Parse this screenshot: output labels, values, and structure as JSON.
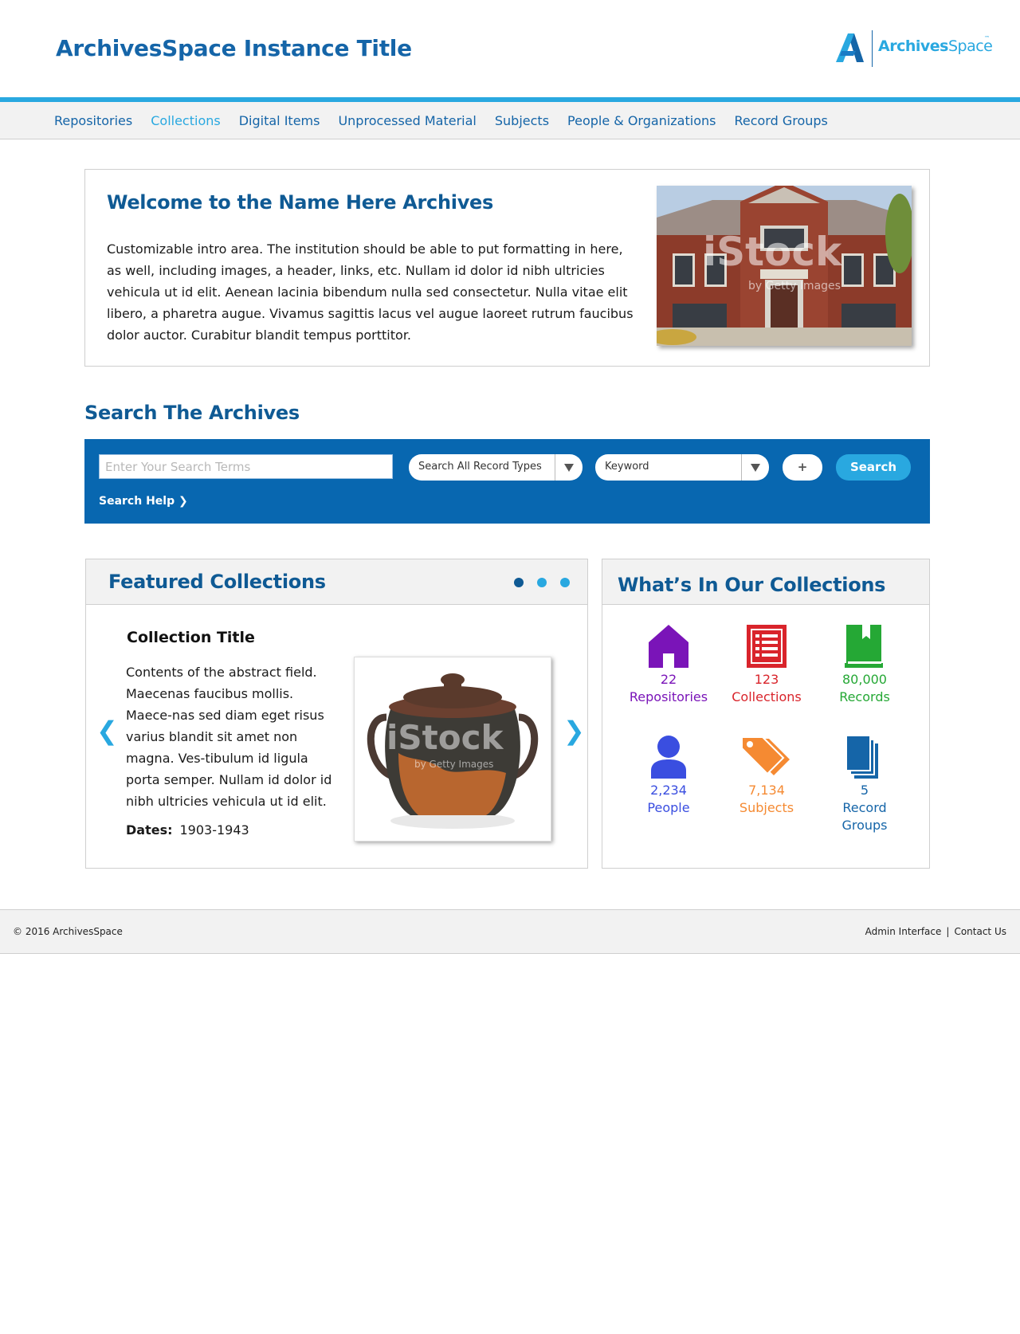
{
  "header": {
    "site_title": "ArchivesSpace Instance Title",
    "logo_text_bold": "Archives",
    "logo_text_light": "Space",
    "logo_tm": "™"
  },
  "nav": {
    "items": [
      {
        "label": "Repositories",
        "active": false
      },
      {
        "label": "Collections",
        "active": true
      },
      {
        "label": "Digital Items",
        "active": false
      },
      {
        "label": "Unprocessed Material",
        "active": false
      },
      {
        "label": "Subjects",
        "active": false
      },
      {
        "label": "People & Organizations",
        "active": false
      },
      {
        "label": "Record Groups",
        "active": false
      }
    ]
  },
  "welcome": {
    "title": "Welcome to the Name Here Archives",
    "body": "Customizable intro area. The institution should be able to put formatting in here, as well, including images, a header, links, etc. Nullam id dolor id nibh ultricies vehicula ut id elit. Aenean lacinia bibendum nulla sed consectetur. Nulla vitae elit libero, a pharetra augue. Vivamus sagittis lacus vel augue laoreet rutrum faucibus dolor auctor. Curabitur blandit tempus porttitor.",
    "photo_watermark": "iStock",
    "photo_watermark_sub": "by Getty Images"
  },
  "search": {
    "heading": "Search The Archives",
    "input_placeholder": "Enter Your Search Terms",
    "record_type_select": "Search All Record Types",
    "field_select": "Keyword",
    "plus_label": "+",
    "button_label": "Search",
    "help_label": "Search Help ❯"
  },
  "featured": {
    "title": "Featured Collections",
    "slide_count": 3,
    "active_slide": 1,
    "collection_title": "Collection Title",
    "abstract": "Contents of the abstract field. Maecenas faucibus mollis. Maece-nas sed diam eget risus varius blandit sit amet non magna. Ves-tibulum id ligula porta semper. Nullam id dolor id nibh ultricies vehicula ut id elit.",
    "dates_label": "Dates:",
    "dates_value": "1903-1943",
    "prev_arrow": "❮",
    "next_arrow": "❯",
    "photo_watermark": "iStock",
    "photo_watermark_sub": "by Getty Images"
  },
  "stats": {
    "title": "What’s In Our Collections",
    "items": [
      {
        "count": "22",
        "label": "Repositories",
        "icon": "home-icon",
        "color": "#7a14b8"
      },
      {
        "count": "123",
        "label": "Collections",
        "icon": "list-icon",
        "color": "#d9242b"
      },
      {
        "count": "80,000",
        "label": "Records",
        "icon": "book-icon",
        "color": "#25a835"
      },
      {
        "count": "2,234",
        "label": "People",
        "icon": "person-icon",
        "color": "#3a4ee0"
      },
      {
        "count": "7,134",
        "label": "Subjects",
        "icon": "tags-icon",
        "color": "#f58a32"
      },
      {
        "count": "5",
        "label": "Record Groups",
        "icon": "stack-icon",
        "color": "#1565a8"
      }
    ]
  },
  "footer": {
    "copyright": "© 2016 ArchivesSpace",
    "admin_link": "Admin Interface",
    "separator": "|",
    "contact_link": "Contact Us"
  },
  "colors": {
    "primary": "#1565a8",
    "accent": "#29a8e0",
    "search_panel": "#0867b0"
  }
}
